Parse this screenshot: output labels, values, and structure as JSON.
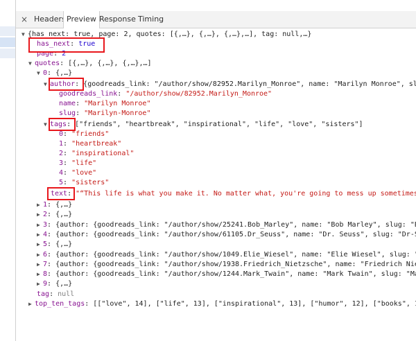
{
  "tabs": {
    "close": "×",
    "items": [
      "Headers",
      "Preview",
      "Response",
      "Timing"
    ],
    "active": "Preview"
  },
  "tree": {
    "root_summary": "{has_next: true, page: 2, quotes: [{,…}, {,…}, {,…},…], tag: null,…}",
    "has_next": {
      "key": "has_next",
      "value": "true"
    },
    "page": {
      "key": "page",
      "value": "2"
    },
    "quotes": {
      "key": "quotes",
      "summary": "[{,…}, {,…}, {,…},…]",
      "item0": {
        "key": "0",
        "summary": "{,…}",
        "author": {
          "key": "author",
          "summary": "{goodreads_link: \"/author/show/82952.Marilyn_Monroe\", name: \"Marilyn Monroe\", slug:",
          "goodreads_link": {
            "key": "goodreads_link",
            "value": "\"/author/show/82952.Marilyn_Monroe\""
          },
          "name": {
            "key": "name",
            "value": "\"Marilyn Monroe\""
          },
          "slug": {
            "key": "slug",
            "value": "\"Marilyn-Monroe\""
          }
        },
        "tags": {
          "key": "tags",
          "summary": "[\"friends\", \"heartbreak\", \"inspirational\", \"life\", \"love\", \"sisters\"]",
          "items": [
            {
              "i": "0",
              "v": "\"friends\""
            },
            {
              "i": "1",
              "v": "\"heartbreak\""
            },
            {
              "i": "2",
              "v": "\"inspirational\""
            },
            {
              "i": "3",
              "v": "\"life\""
            },
            {
              "i": "4",
              "v": "\"love\""
            },
            {
              "i": "5",
              "v": "\"sisters\""
            }
          ]
        },
        "text": {
          "key": "text",
          "value": "\"“This life is what you make it. No matter what, you're going to mess up sometimes,"
        }
      },
      "others": [
        {
          "i": "1",
          "summary": "{,…}"
        },
        {
          "i": "2",
          "summary": "{,…}"
        },
        {
          "i": "3",
          "summary": "{author: {goodreads_link: \"/author/show/25241.Bob_Marley\", name: \"Bob Marley\", slug: \"Bo"
        },
        {
          "i": "4",
          "summary": "{author: {goodreads_link: \"/author/show/61105.Dr_Seuss\", name: \"Dr. Seuss\", slug: \"Dr-Se"
        },
        {
          "i": "5",
          "summary": "{,…}"
        },
        {
          "i": "6",
          "summary": "{author: {goodreads_link: \"/author/show/1049.Elie_Wiesel\", name: \"Elie Wiesel\", slug: \"Eli"
        },
        {
          "i": "7",
          "summary": "{author: {goodreads_link: \"/author/show/1938.Friedrich_Nietzsche\", name: \"Friedrich Niet"
        },
        {
          "i": "8",
          "summary": "{author: {goodreads_link: \"/author/show/1244.Mark_Twain\", name: \"Mark Twain\", slug: \"Mar"
        },
        {
          "i": "9",
          "summary": "{,…}"
        }
      ]
    },
    "tag": {
      "key": "tag",
      "value": "null"
    },
    "top_ten_tags": {
      "key": "top_ten_tags",
      "summary": "[[\"love\", 14], [\"life\", 13], [\"inspirational\", 13], [\"humor\", 12], [\"books\", 1"
    }
  }
}
